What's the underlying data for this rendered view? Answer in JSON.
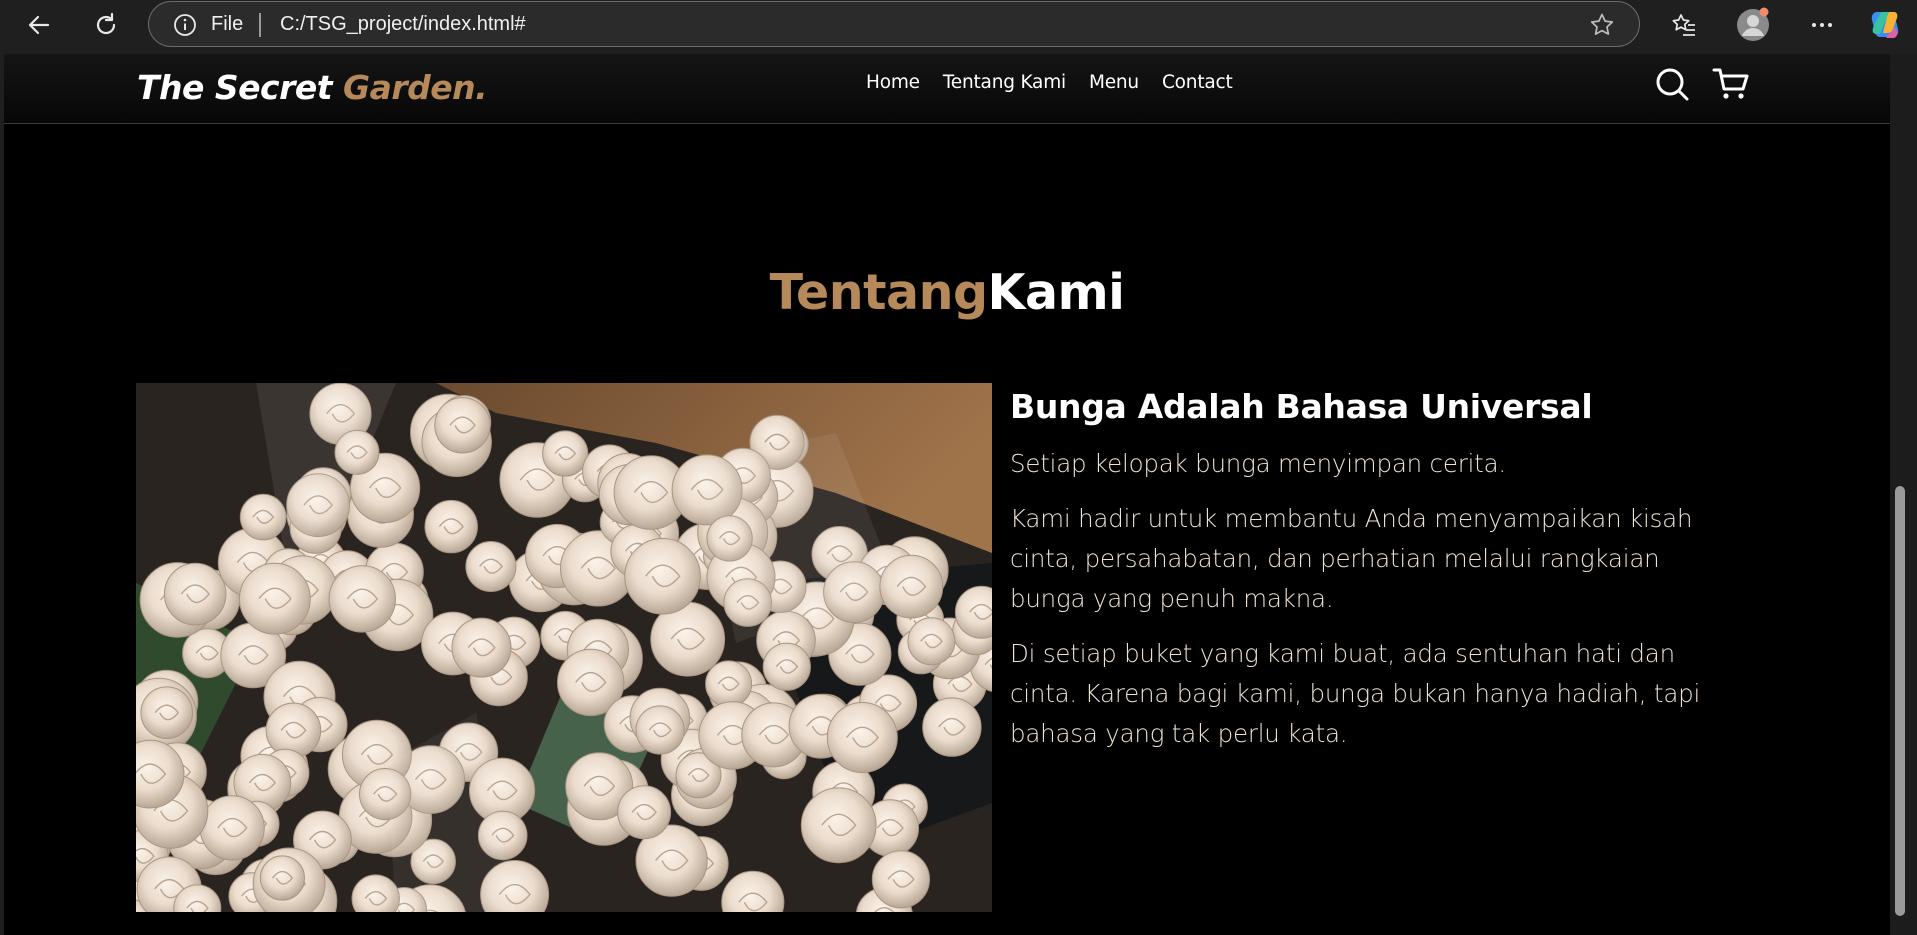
{
  "browser": {
    "address_prefix": "File",
    "url": "C:/TSG_project/index.html#"
  },
  "site": {
    "brand_main": "The Secret ",
    "brand_accent": "Garden.",
    "nav": [
      "Home",
      "Tentang Kami",
      "Menu",
      "Contact"
    ],
    "accent_color": "#b6895b"
  },
  "about": {
    "title_accent": "Tentang",
    "title_main": "Kami",
    "heading": "Bunga Adalah Bahasa Universal",
    "paragraphs": [
      "Setiap kelopak bunga menyimpan cerita.",
      "Kami hadir untuk membantu Anda menyampaikan kisah cinta, persahabatan, dan perhatian melalui rangkaian bunga yang penuh makna.",
      "Di setiap buket yang kami buat, ada sentuhan hati dan cinta. Karena bagi kami, bunga bukan hanya hadiah, tapi bahasa yang tak perlu kata."
    ]
  }
}
